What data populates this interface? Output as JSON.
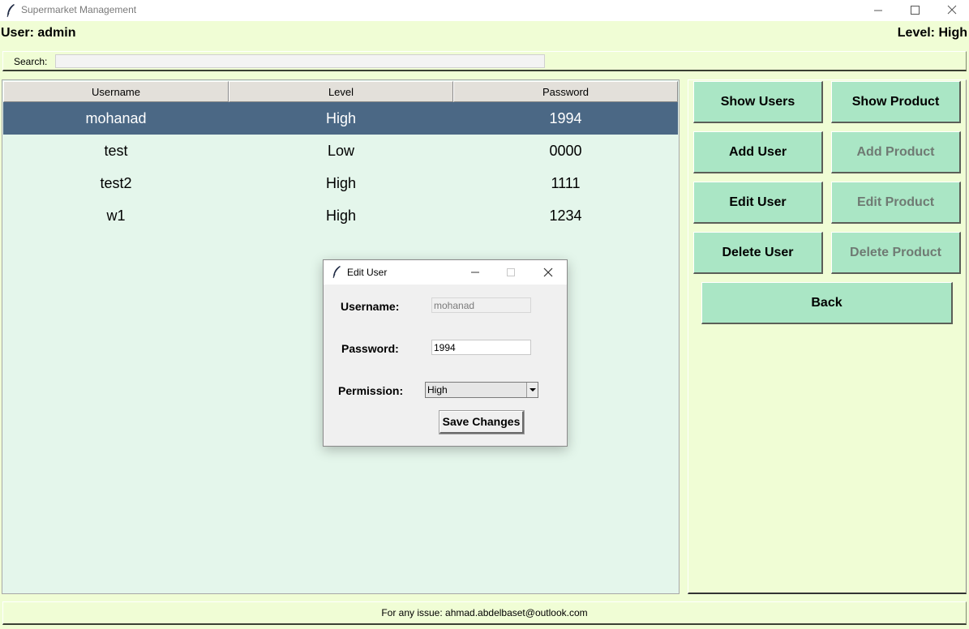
{
  "window": {
    "title": "Supermarket Management"
  },
  "header": {
    "user": "User: admin",
    "level": "Level: High"
  },
  "search": {
    "label": "Search:",
    "value": ""
  },
  "table": {
    "columns": [
      "Username",
      "Level",
      "Password"
    ],
    "rows": [
      [
        "mohanad",
        "High",
        "1994"
      ],
      [
        "test",
        "Low",
        "0000"
      ],
      [
        "test2",
        "High",
        "1111"
      ],
      [
        "w1",
        "High",
        "1234"
      ]
    ],
    "selected_row": 0,
    "selected_color": "#4b6885"
  },
  "panel": {
    "show_users": "Show Users",
    "show_product": "Show Product",
    "add_user": "Add User",
    "add_product": "Add Product",
    "edit_user": "Edit User",
    "edit_product": "Edit Product",
    "delete_user": "Delete User",
    "delete_product": "Delete Product",
    "back": "Back",
    "button_color": "#aae6c5"
  },
  "footer": {
    "text": "For any issue: ahmad.abdelbaset@outlook.com"
  },
  "dialog": {
    "title": "Edit User",
    "username_label": "Username:",
    "username_value": "mohanad",
    "password_label": "Password:",
    "password_value": "1994",
    "permission_label": "Permission:",
    "permission_value": "High",
    "save_label": "Save Changes"
  },
  "colors": {
    "background": "#f0fdd5",
    "table_background": "#e4f6eb"
  }
}
